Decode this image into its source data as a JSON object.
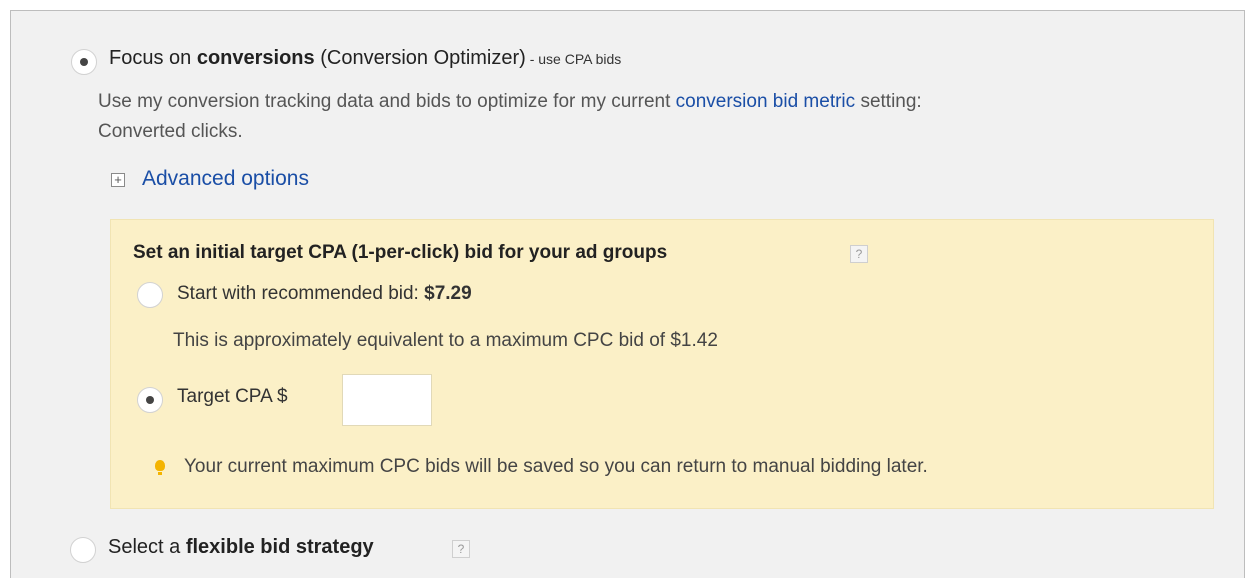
{
  "option_conversions": {
    "label_prefix": "Focus on ",
    "label_bold": "conversions",
    "label_suffix": " (Conversion Optimizer)",
    "label_small": " - use CPA bids",
    "desc_before_link": "Use my conversion tracking data and bids to optimize for my current ",
    "desc_link": "conversion bid metric",
    "desc_after_link": " setting:",
    "desc_line2": "Converted clicks.",
    "advanced_options_label": "Advanced options",
    "expand_symbol": "+",
    "selected": true
  },
  "cpa_panel": {
    "heading": "Set an initial target CPA (1-per-click) bid for your ad groups",
    "help_symbol": "?",
    "recommended": {
      "label": "Start with recommended bid: ",
      "value": "$7.29",
      "selected": false
    },
    "equivalent_note": "This is approximately equivalent to a maximum CPC bid of $1.42",
    "target": {
      "label": "Target CPA $",
      "input_value": "",
      "selected": true
    },
    "tip": "Your current maximum CPC bids will be saved so you can return to manual bidding later.",
    "accent_color": "#fbf0c7",
    "tip_icon": "lightbulb-icon"
  },
  "option_flexible": {
    "label_prefix": "Select a ",
    "label_bold": "flexible bid strategy",
    "help_symbol": "?",
    "selected": false
  },
  "colors": {
    "panel_bg": "#f1f1f1",
    "link": "#1a4ea6",
    "bulb": "#f4b400"
  }
}
